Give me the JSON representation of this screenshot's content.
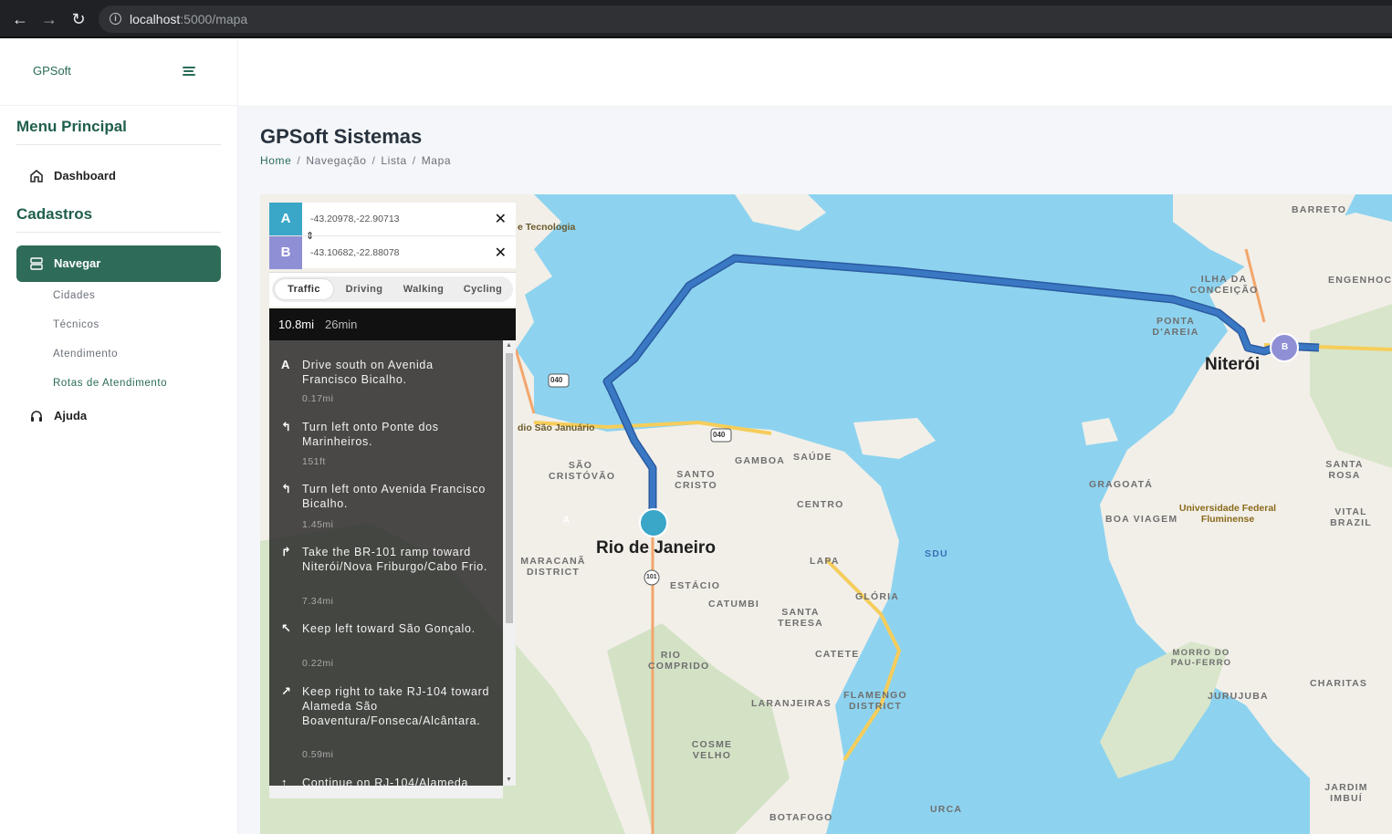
{
  "browser": {
    "url_host": "localhost",
    "url_path": ":5000/mapa"
  },
  "sidebar": {
    "brand": "GPSoft",
    "section_main": "Menu Principal",
    "dashboard": "Dashboard",
    "section_cad": "Cadastros",
    "navegar": "Navegar",
    "subitems": [
      "Cidades",
      "Técnicos",
      "Atendimento",
      "Rotas de Atendimento"
    ],
    "ajuda": "Ajuda"
  },
  "page": {
    "title": "GPSoft Sistemas",
    "breadcrumb": [
      "Home",
      "Navegação",
      "Lista",
      "Mapa"
    ]
  },
  "directions": {
    "origin_label": "A",
    "origin_value": "-43.20978,-22.90713",
    "dest_label": "B",
    "dest_value": "-43.10682,-22.88078",
    "profiles": [
      "Traffic",
      "Driving",
      "Walking",
      "Cycling"
    ],
    "selected_profile": "Traffic",
    "distance": "10.8mi",
    "duration": "26min",
    "steps": [
      {
        "icon": "A",
        "text": "Drive south on Avenida Francisco Bicalho.",
        "dist": "0.17mi"
      },
      {
        "icon": "↰",
        "text": "Turn left onto Ponte dos Marinheiros.",
        "dist": "151ft"
      },
      {
        "icon": "↰",
        "text": "Turn left onto Avenida Francisco Bicalho.",
        "dist": "1.45mi"
      },
      {
        "icon": "↱",
        "text": "Take the BR-101 ramp toward Niterói/Nova Friburgo/Cabo Frio.",
        "dist": "7.34mi"
      },
      {
        "icon": "↖",
        "text": "Keep left toward São Gonçalo.",
        "dist": "0.22mi"
      },
      {
        "icon": "↗",
        "text": "Keep right to take RJ-104 toward Alameda São Boaventura/Fonseca/Alcântara.",
        "dist": "0.59mi"
      },
      {
        "icon": "↑",
        "text": "Continue on RJ-104/Alameda",
        "dist": ""
      }
    ]
  },
  "map": {
    "cities": [
      "Rio de Janeiro",
      "Niterói"
    ],
    "labels": [
      "BARRETO",
      "ENGENHOCA",
      "ILHA DA CONCEIÇÃO",
      "PONTA D'AREIA",
      "SANTA ROSA",
      "GRAGOATÁ",
      "BOA VIAGEM",
      "VITAL BRAZIL",
      "GAMBOA",
      "SAÚDE",
      "SANTO CRISTO",
      "SÃO CRISTÓVÃO",
      "CENTRO",
      "LAPA",
      "GLÓRIA",
      "ESTÁCIO",
      "CATUMBI",
      "SANTA TERESA",
      "CATETE",
      "RIO COMPRIDO",
      "LARANJEIRAS",
      "FLAMENGO DISTRICT",
      "MARACANÃ DISTRICT",
      "COSME VELHO",
      "BOTAFOGO",
      "URCA",
      "MORRO DO PAU-FERRO",
      "JURUJUBA",
      "CHARITAS",
      "JARDIM IMBUÍ",
      "SDU",
      "Universidade Federal Fluminense",
      "e Tecnologia",
      "dio São Januário"
    ],
    "marker_a": "A",
    "marker_b": "B",
    "shields": [
      "040",
      "040",
      "101"
    ],
    "colors": {
      "water": "#8dd3ef",
      "land": "#f2efe9",
      "route": "#3b73b9",
      "marker_a": "#3aa6c8",
      "marker_b": "#8f8fd6"
    }
  }
}
